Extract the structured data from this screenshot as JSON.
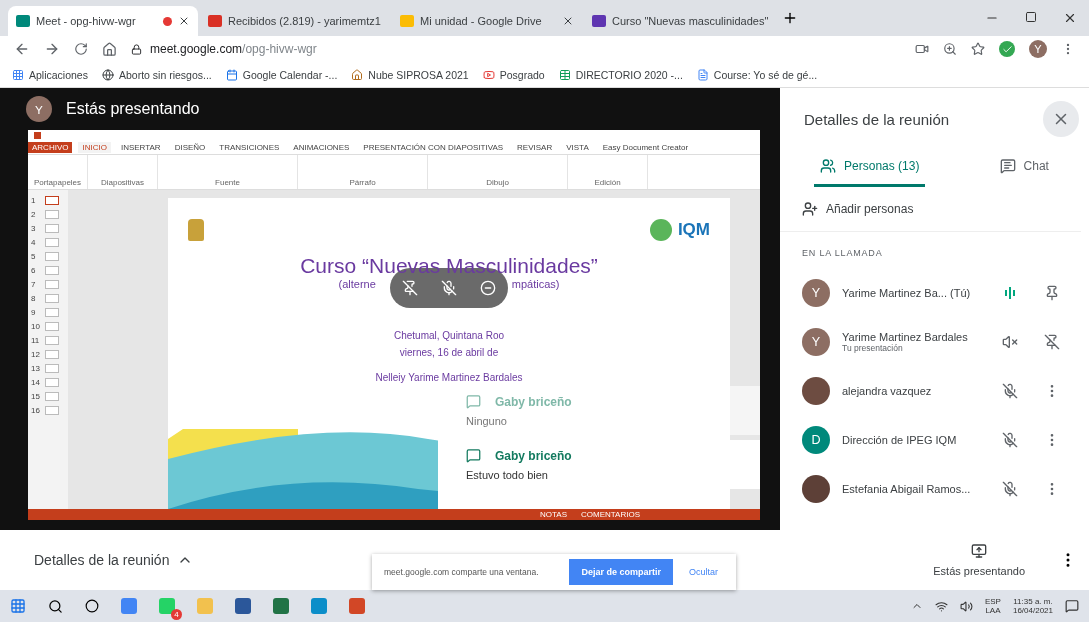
{
  "browser": {
    "tabs": [
      {
        "title": "Meet - opg-hivw-wgr",
        "kind": "meet",
        "recording": true,
        "selected": true
      },
      {
        "title": "Recibidos (2.819) - yarimemtz1",
        "kind": "gmail",
        "recording": false,
        "selected": false
      },
      {
        "title": "Mi unidad - Google Drive",
        "kind": "drive",
        "recording": false,
        "selected": false
      },
      {
        "title": "Curso \"Nuevas masculinidades\"",
        "kind": "slides",
        "recording": false,
        "selected": false
      }
    ],
    "url_host": "meet.google.com",
    "url_path": "/opg-hivw-wgr",
    "bookmarks": [
      {
        "label": "Aplicaciones",
        "kind": "apps"
      },
      {
        "label": "Aborto sin riesgos...",
        "kind": "globe"
      },
      {
        "label": "Google Calendar -...",
        "kind": "calendar"
      },
      {
        "label": "Nube SIPROSA 2021",
        "kind": "house"
      },
      {
        "label": "Posgrado",
        "kind": "youtube"
      },
      {
        "label": "DIRECTORIO 2020 -...",
        "kind": "sheet"
      },
      {
        "label": "Course: Yo sé de gé...",
        "kind": "doc"
      }
    ],
    "profile_letter": "Y"
  },
  "presenter": {
    "avatar_letter": "Y",
    "label": "Estás presentando"
  },
  "powerpoint": {
    "ribbon_tabs": [
      {
        "label": "ARCHIVO",
        "selected": false,
        "kind": "file"
      },
      {
        "label": "INICIO",
        "selected": true,
        "kind": "tab"
      },
      {
        "label": "INSERTAR",
        "selected": false,
        "kind": "tab"
      },
      {
        "label": "DISEÑO",
        "selected": false,
        "kind": "tab"
      },
      {
        "label": "TRANSICIONES",
        "selected": false,
        "kind": "tab"
      },
      {
        "label": "ANIMACIONES",
        "selected": false,
        "kind": "tab"
      },
      {
        "label": "PRESENTACIÓN CON DIAPOSITIVAS",
        "selected": false,
        "kind": "tab"
      },
      {
        "label": "REVISAR",
        "selected": false,
        "kind": "tab"
      },
      {
        "label": "VISTA",
        "selected": false,
        "kind": "tab"
      },
      {
        "label": "Easy Document Creator",
        "selected": false,
        "kind": "tab"
      }
    ],
    "ribbon_groups": [
      "Portapapeles",
      "Diapositivas",
      "Fuente",
      "Párrafo",
      "Dibujo",
      "Edición"
    ],
    "thumbnails": [
      {
        "number": "1",
        "selected": true
      },
      {
        "number": "2",
        "selected": false
      },
      {
        "number": "3",
        "selected": false
      },
      {
        "number": "4",
        "selected": false
      },
      {
        "number": "5",
        "selected": false
      },
      {
        "number": "6",
        "selected": false
      },
      {
        "number": "7",
        "selected": false
      },
      {
        "number": "8",
        "selected": false
      },
      {
        "number": "9",
        "selected": false
      },
      {
        "number": "10",
        "selected": false
      },
      {
        "number": "11",
        "selected": false
      },
      {
        "number": "12",
        "selected": false
      },
      {
        "number": "13",
        "selected": false
      },
      {
        "number": "14",
        "selected": false
      },
      {
        "number": "15",
        "selected": false
      },
      {
        "number": "16",
        "selected": false
      }
    ],
    "slide": {
      "logo_text": "IQM",
      "title": "Curso “Nuevas Masculinidades”",
      "subtitle_left": "(alterne",
      "subtitle_right": "mpáticas)",
      "place": "Chetumal, Quintana Roo",
      "date": "viernes, 16 de abril de",
      "author": "Nelleiy Yarime Martinez Bardales"
    },
    "status_items": [
      "NOTAS",
      "COMENTARIOS"
    ]
  },
  "notifications": [
    {
      "name": "Gaby briceño",
      "message": "Ninguno",
      "faded": true
    },
    {
      "name": "Gaby briceño",
      "message": "Estuvo todo bien",
      "faded": false
    }
  ],
  "panel": {
    "title": "Detalles de la reunión",
    "tabs": [
      {
        "label": "Personas (13)",
        "selected": true,
        "kind": "people"
      },
      {
        "label": "Chat",
        "selected": false,
        "kind": "chat"
      }
    ],
    "add_people": "Añadir personas",
    "section": "EN LA LLAMADA",
    "participants": [
      {
        "name": "Yarime Martinez Ba...",
        "suffix": "(Tú)",
        "kind": "letter",
        "letter": "Y",
        "color": "#8d6e63",
        "speaking": true,
        "presentation": false,
        "self": true
      },
      {
        "name": "Yarime Martinez Bardales",
        "subtitle": "Tu presentación",
        "kind": "letter",
        "letter": "Y",
        "color": "#8d6e63",
        "speaking": false,
        "presentation": true,
        "self": false
      },
      {
        "name": "alejandra vazquez",
        "kind": "photo",
        "color": "#6d4c41",
        "speaking": false,
        "presentation": false,
        "self": false
      },
      {
        "name": "Dirección de IPEG IQM",
        "kind": "letter",
        "letter": "D",
        "color": "#00897b",
        "speaking": false,
        "presentation": false,
        "self": false
      },
      {
        "name": "Estefania Abigail Ramos...",
        "kind": "photo",
        "color": "#5d4037",
        "speaking": false,
        "presentation": false,
        "self": false
      }
    ]
  },
  "bottom": {
    "details": "Detalles de la reunión",
    "share_notice": "meet.google.com comparte una ventana.",
    "stop_button": "Dejar de compartir",
    "hide_button": "Ocultar",
    "presenting_label": "Estás presentando"
  },
  "taskbar": {
    "whatsapp_badge": "4",
    "language": "ESP",
    "layout": "LAA",
    "time": "11:35 a. m.",
    "date": "16/04/2021"
  }
}
